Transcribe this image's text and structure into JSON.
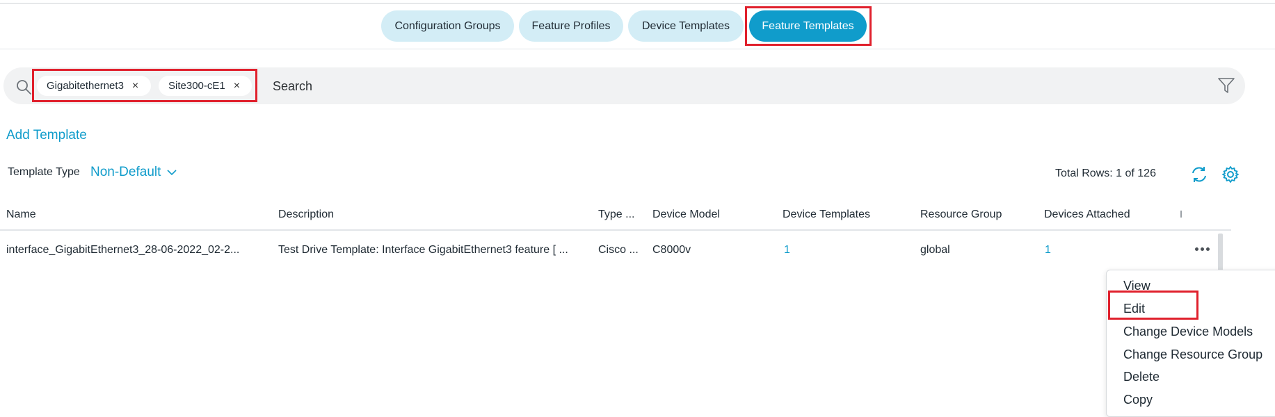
{
  "tabs": [
    {
      "label": "Configuration Groups",
      "active": false
    },
    {
      "label": "Feature Profiles",
      "active": false
    },
    {
      "label": "Device Templates",
      "active": false
    },
    {
      "label": "Feature Templates",
      "active": true
    }
  ],
  "search": {
    "chips": [
      {
        "label": "Gigabitethernet3",
        "remove": "×"
      },
      {
        "label": "Site300-cE1",
        "remove": "×"
      }
    ],
    "placeholder": "Search"
  },
  "add_template_label": "Add Template",
  "template_type": {
    "label": "Template Type",
    "value": "Non-Default"
  },
  "total_rows": "Total Rows: 1 of 126",
  "table": {
    "columns": [
      "Name",
      "Description",
      "Type ...",
      "Device Model",
      "Device Templates",
      "Resource Group",
      "Devices Attached"
    ],
    "rows": [
      {
        "name": "interface_GigabitEthernet3_28-06-2022_02-2...",
        "description": "Test Drive Template: Interface GigabitEthernet3 feature [ ...",
        "type": "Cisco ...",
        "device_model": "C8000v",
        "device_templates": "1",
        "resource_group": "global",
        "devices_attached": "1"
      }
    ]
  },
  "context_menu": {
    "items": [
      "View",
      "Edit",
      "Change Device Models",
      "Change Resource Group",
      "Delete",
      "Copy"
    ],
    "highlighted": "Edit"
  },
  "colors": {
    "accent": "#109ccb",
    "tab_bg": "#d3edf6",
    "highlight_box": "#e0202c"
  },
  "icons": [
    "search-icon",
    "close-icon",
    "filter-icon",
    "chevron-down-icon",
    "refresh-icon",
    "gear-icon",
    "more-horizontal-icon"
  ]
}
